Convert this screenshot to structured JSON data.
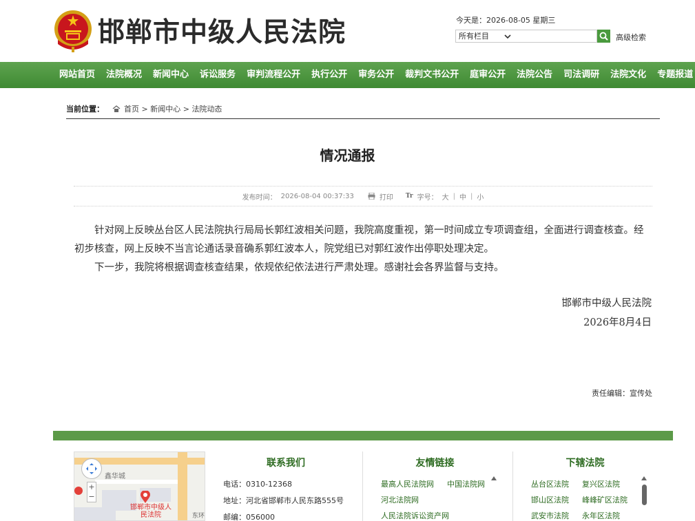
{
  "header": {
    "site_title": "邯郸市中级人民法院",
    "date_text": "今天是：2026-08-05 星期三",
    "search_select": "所有栏目",
    "search_placeholder": "",
    "advanced_search": "高级检索"
  },
  "nav": {
    "items": [
      "网站首页",
      "法院概况",
      "新闻中心",
      "诉讼服务",
      "审判流程公开",
      "执行公开",
      "审务公开",
      "裁判文书公开",
      "庭审公开",
      "法院公告",
      "司法调研",
      "法院文化",
      "专题报道"
    ]
  },
  "breadcrumb": {
    "label": "当前位置：",
    "items": [
      "首页",
      "新闻中心",
      "法院动态"
    ],
    "sep": " > "
  },
  "article": {
    "title": "情况通报",
    "publish_label": "发布时间：",
    "publish_time": "2026-08-04 00:37:33",
    "print": "打印",
    "font_label": "字号：",
    "font_large": "大",
    "font_medium": "中",
    "font_small": "小",
    "paragraphs": [
      "针对网上反映丛台区人民法院执行局局长郭红波相关问题，我院高度重视，第一时间成立专项调查组，全面进行调查核查。经初步核查，网上反映不当言论通话录音确系郭红波本人，院党组已对郭红波作出停职处理决定。",
      "下一步，我院将根据调查核查结果，依规依纪依法进行严肃处理。感谢社会各界监督与支持。"
    ],
    "signature": "邯郸市中级人民法院",
    "date": "2026年8月4日",
    "editor_label": "责任编辑：",
    "editor": "宣传处"
  },
  "footer": {
    "map_labels": [
      "鑫华城",
      "邯郸市中级人民法院",
      "东环"
    ],
    "contact": {
      "title": "联系我们",
      "phone_label": "电话：",
      "phone": "0310-12368",
      "address_label": "地址：",
      "address": "河北省邯郸市人民东路555号",
      "postcode_label": "邮编：",
      "postcode": "056000"
    },
    "links": {
      "title": "友情链接",
      "items": [
        "最高人民法院网",
        "中国法院网",
        "河北法院网",
        "",
        "人民法院诉讼资产网",
        ""
      ]
    },
    "courts": {
      "title": "下辖法院",
      "items": [
        "丛台区法院",
        "复兴区法院",
        "邯山区法院",
        "峰峰矿区法院",
        "武安市法院",
        "永年区法院"
      ]
    }
  },
  "colors": {
    "nav_green": "#4a9a3e",
    "footer_green": "#5c9a48",
    "link_green": "#2d6b21"
  }
}
